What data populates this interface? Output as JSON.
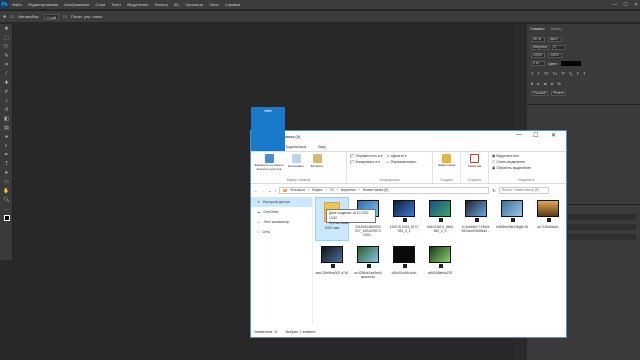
{
  "menubar": {
    "logo": "Ps",
    "items": [
      "Файл",
      "Редактирование",
      "Изображение",
      "Слои",
      "Текст",
      "Выделение",
      "Фильтр",
      "3D",
      "Просмотр",
      "Окно",
      "Справка"
    ]
  },
  "window_controls": {
    "min": "—",
    "max": "☐",
    "close": "✕"
  },
  "options": {
    "autoselect": "Автовыбор:",
    "layer": "Слой",
    "show_controls": "Показ. упр. элем."
  },
  "right_panel": {
    "tab1": "Символ",
    "tab2": "Абзац",
    "font_size": "36 пт",
    "leading": "Авто",
    "tracking": "0",
    "kerning": "Метрики",
    "scale_v": "100%",
    "scale_h": "100%",
    "baseline": "0 пт",
    "color_label": "Цвет:",
    "language": "Русский",
    "aa": "Резкое"
  },
  "explorer": {
    "title": "Новая папка (5)",
    "tabs": [
      "Файл",
      "Главная",
      "Поделиться",
      "Вид"
    ],
    "ribbon": {
      "pin": "Закрепить на панели быстрого доступа",
      "copy": "Копировать",
      "paste": "Вставить",
      "clip_group": "Буфер обмена",
      "move": "Переместить в ▾",
      "copy_to": "Копировать в ▾",
      "delete": "Удалить ▾",
      "rename": "Переименовать",
      "org_group": "Упорядочить",
      "new_folder": "Новая папка",
      "create_group": "Создать",
      "properties": "Свойства",
      "open_group": "Открыть",
      "select_all": "Выделить все",
      "select_none": "Снять выделение",
      "invert": "Обратить выделение",
      "select_group": "Выделить"
    },
    "address": [
      "Фотошоп",
      "Видео",
      "74",
      "Картинки",
      "Новая папка (5)"
    ],
    "search_placeholder": "Поиск: Новая папка (5)",
    "nav": [
      "Быстрый доступ",
      "OneDrive",
      "Этот компьютер",
      "Сеть"
    ],
    "files": [
      "1000 лмм",
      "20160544820000 007_1594229074 1533...",
      "151078 1094_8172 934_3_2",
      "15623484 6_8661 569_2_2",
      "b1ed0e8e7719d0e 2824ec9260b5a4 ...",
      "e4f06ee06e248gfb 45",
      "ac7126d0ea2c",
      "ace126ef6ea002 a7b2",
      "ac4255ce1ae5ee6 aeacbc4d",
      "c56c15cd5c1ecd",
      "cdf6305ae6a233"
    ],
    "tooltip_line1": "Дата создания: 16.10.2020 13:50",
    "tooltip_line2": "Пустая папка",
    "status_count": "Элементов: 11",
    "status_sel": "Выбран 1 элемент"
  }
}
